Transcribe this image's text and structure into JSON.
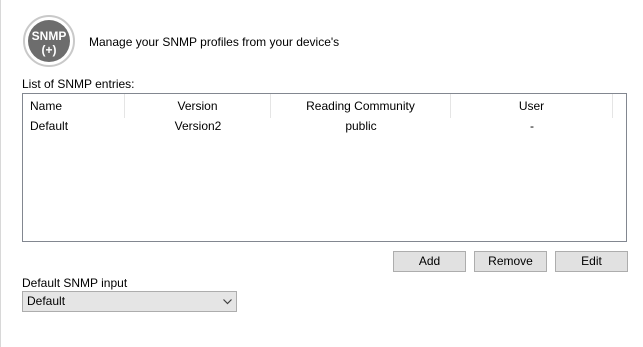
{
  "header": {
    "logo_text": "SNMP",
    "logo_symbol": "(+)",
    "logo_icon": "snmp-badge-icon",
    "description": "Manage your SNMP profiles from your device's"
  },
  "list": {
    "label": "List of SNMP entries:",
    "columns": [
      "Name",
      "Version",
      "Reading Community",
      "User"
    ],
    "rows": [
      {
        "name": "Default",
        "version": "Version2",
        "reading_community": "public",
        "user": "-"
      }
    ]
  },
  "buttons": {
    "add": "Add",
    "remove": "Remove",
    "edit": "Edit"
  },
  "default_input": {
    "label": "Default SNMP input",
    "selected": "Default",
    "arrow_icon": "chevron-down-icon"
  },
  "colors": {
    "logo_gray": "#6d6d6d",
    "list_border": "#828790",
    "button_face": "#e1e1e1",
    "button_border": "#adadad"
  }
}
